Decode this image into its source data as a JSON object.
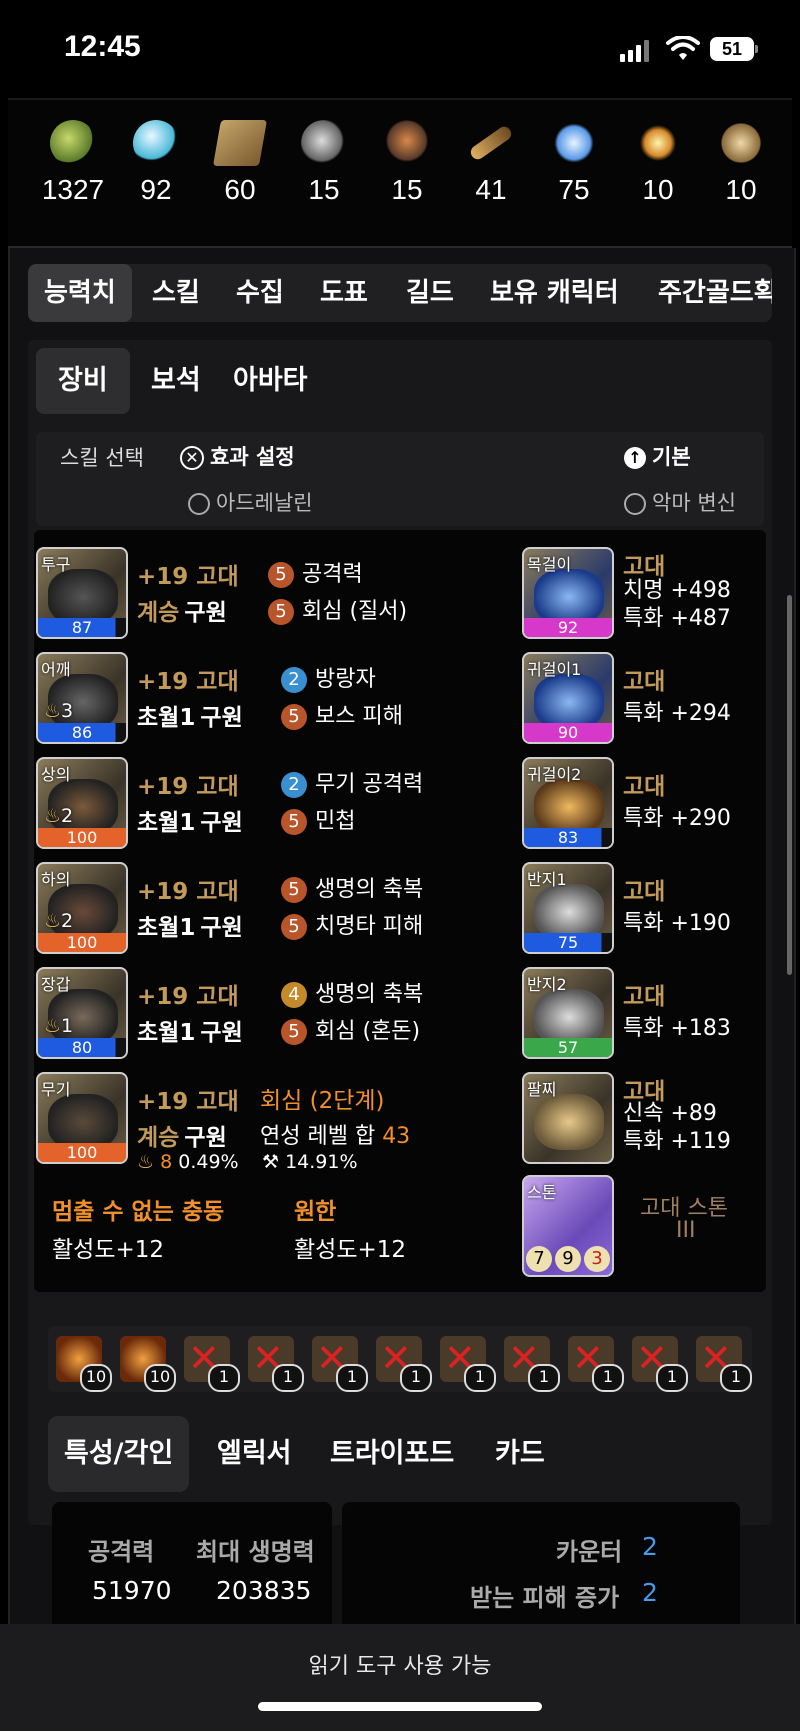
{
  "status": {
    "time": "12:45",
    "battery": "51"
  },
  "resources": [
    {
      "icon": "seed-icon",
      "value": "1327"
    },
    {
      "icon": "orb-icon",
      "value": "92"
    },
    {
      "icon": "map-icon",
      "value": "60"
    },
    {
      "icon": "heart-icon",
      "value": "15"
    },
    {
      "icon": "mask-icon",
      "value": "15"
    },
    {
      "icon": "telescope-icon",
      "value": "41"
    },
    {
      "icon": "leaf-icon",
      "value": "75"
    },
    {
      "icon": "star-icon",
      "value": "10"
    },
    {
      "icon": "medal-icon",
      "value": "10"
    }
  ],
  "tabs_main": [
    "능력치",
    "스킬",
    "수집",
    "도표",
    "길드",
    "보유 캐릭터",
    "주간골드획"
  ],
  "tabs_sub": [
    "장비",
    "보석",
    "아바타"
  ],
  "skill_bar": {
    "skill_select": "스킬 선택",
    "effect_setting": "효과 설정",
    "adrenaline": "아드레날린",
    "basic": "기본",
    "demon": "악마 변신"
  },
  "equipment": [
    {
      "slot": "투구",
      "quality": "87",
      "refine": "+19 고대",
      "set_a": "계승",
      "set_b": "구원",
      "eng": [
        {
          "lv": "5",
          "name": "공격력"
        },
        {
          "lv": "5",
          "name": "회심 (질서)"
        }
      ]
    },
    {
      "slot": "어깨",
      "lvl": "3",
      "quality": "86",
      "refine": "+19 고대",
      "set_a": "초월1",
      "set_b": "구원",
      "eng": [
        {
          "lv": "2",
          "name": "방랑자"
        },
        {
          "lv": "5",
          "name": "보스 피해"
        }
      ]
    },
    {
      "slot": "상의",
      "lvl": "2",
      "quality": "100",
      "refine": "+19 고대",
      "set_a": "초월1",
      "set_b": "구원",
      "eng": [
        {
          "lv": "2",
          "name": "무기 공격력"
        },
        {
          "lv": "5",
          "name": "민첩"
        }
      ]
    },
    {
      "slot": "하의",
      "lvl": "2",
      "quality": "100",
      "refine": "+19 고대",
      "set_a": "초월1",
      "set_b": "구원",
      "eng": [
        {
          "lv": "5",
          "name": "생명의 축복"
        },
        {
          "lv": "5",
          "name": "치명타 피해"
        }
      ]
    },
    {
      "slot": "장갑",
      "lvl": "1",
      "quality": "80",
      "refine": "+19 고대",
      "set_a": "초월1",
      "set_b": "구원",
      "eng": [
        {
          "lv": "4",
          "name": "생명의 축복"
        },
        {
          "lv": "5",
          "name": "회심 (혼돈)"
        }
      ]
    }
  ],
  "weapon": {
    "slot": "무기",
    "quality": "100",
    "refine": "+19 고대",
    "set_a": "계승",
    "set_b": "구원",
    "special": "회심 (2단계)",
    "sum_label": "연성 레벨 합",
    "sum_value": "43",
    "stat1_lv": "8",
    "stat1_pct": "0.49%",
    "stat2_pct": "14.91%"
  },
  "set_effects": [
    {
      "name": "멈출 수 없는 충동",
      "value": "활성도+12"
    },
    {
      "name": "원한",
      "value": "활성도+12"
    }
  ],
  "accessories": [
    {
      "slot": "목걸이",
      "quality": "92",
      "grade": "고대",
      "lines": [
        "치명 +498",
        "특화 +487"
      ]
    },
    {
      "slot": "귀걸이1",
      "quality": "90",
      "grade": "고대",
      "lines": [
        "특화 +294"
      ]
    },
    {
      "slot": "귀걸이2",
      "quality": "83",
      "grade": "고대",
      "lines": [
        "특화 +290"
      ]
    },
    {
      "slot": "반지1",
      "quality": "75",
      "grade": "고대",
      "lines": [
        "특화 +190"
      ]
    },
    {
      "slot": "반지2",
      "quality": "57",
      "grade": "고대",
      "lines": [
        "특화 +183"
      ]
    },
    {
      "slot": "팔찌",
      "grade": "고대",
      "lines": [
        "신속 +89",
        "특화 +119"
      ]
    }
  ],
  "stone": {
    "slot": "스톤",
    "name": "고대 스톤",
    "tier": "III",
    "e1": "7",
    "e2": "9",
    "e3": "3"
  },
  "gems": [
    "10",
    "10",
    "1",
    "1",
    "1",
    "1",
    "1",
    "1",
    "1",
    "1",
    "1"
  ],
  "tabs_bottom": [
    "특성/각인",
    "엘릭서",
    "트라이포드",
    "카드"
  ],
  "stats": {
    "atk_label": "공격력",
    "atk": "51970",
    "hp_label": "최대 생명력",
    "hp": "203835"
  },
  "traits": [
    {
      "name": "카운터",
      "value": "2"
    },
    {
      "name": "받는 피해 증가",
      "value": "2"
    }
  ],
  "reader": "읽기 도구 사용 가능",
  "colors": {
    "gold": "#c29a5a",
    "orange": "#f0902a",
    "blue_bar": "#1f5be0",
    "orange_bar": "#e4632a",
    "pink_bar": "#d638c9",
    "green_bar": "#3aa84a"
  }
}
